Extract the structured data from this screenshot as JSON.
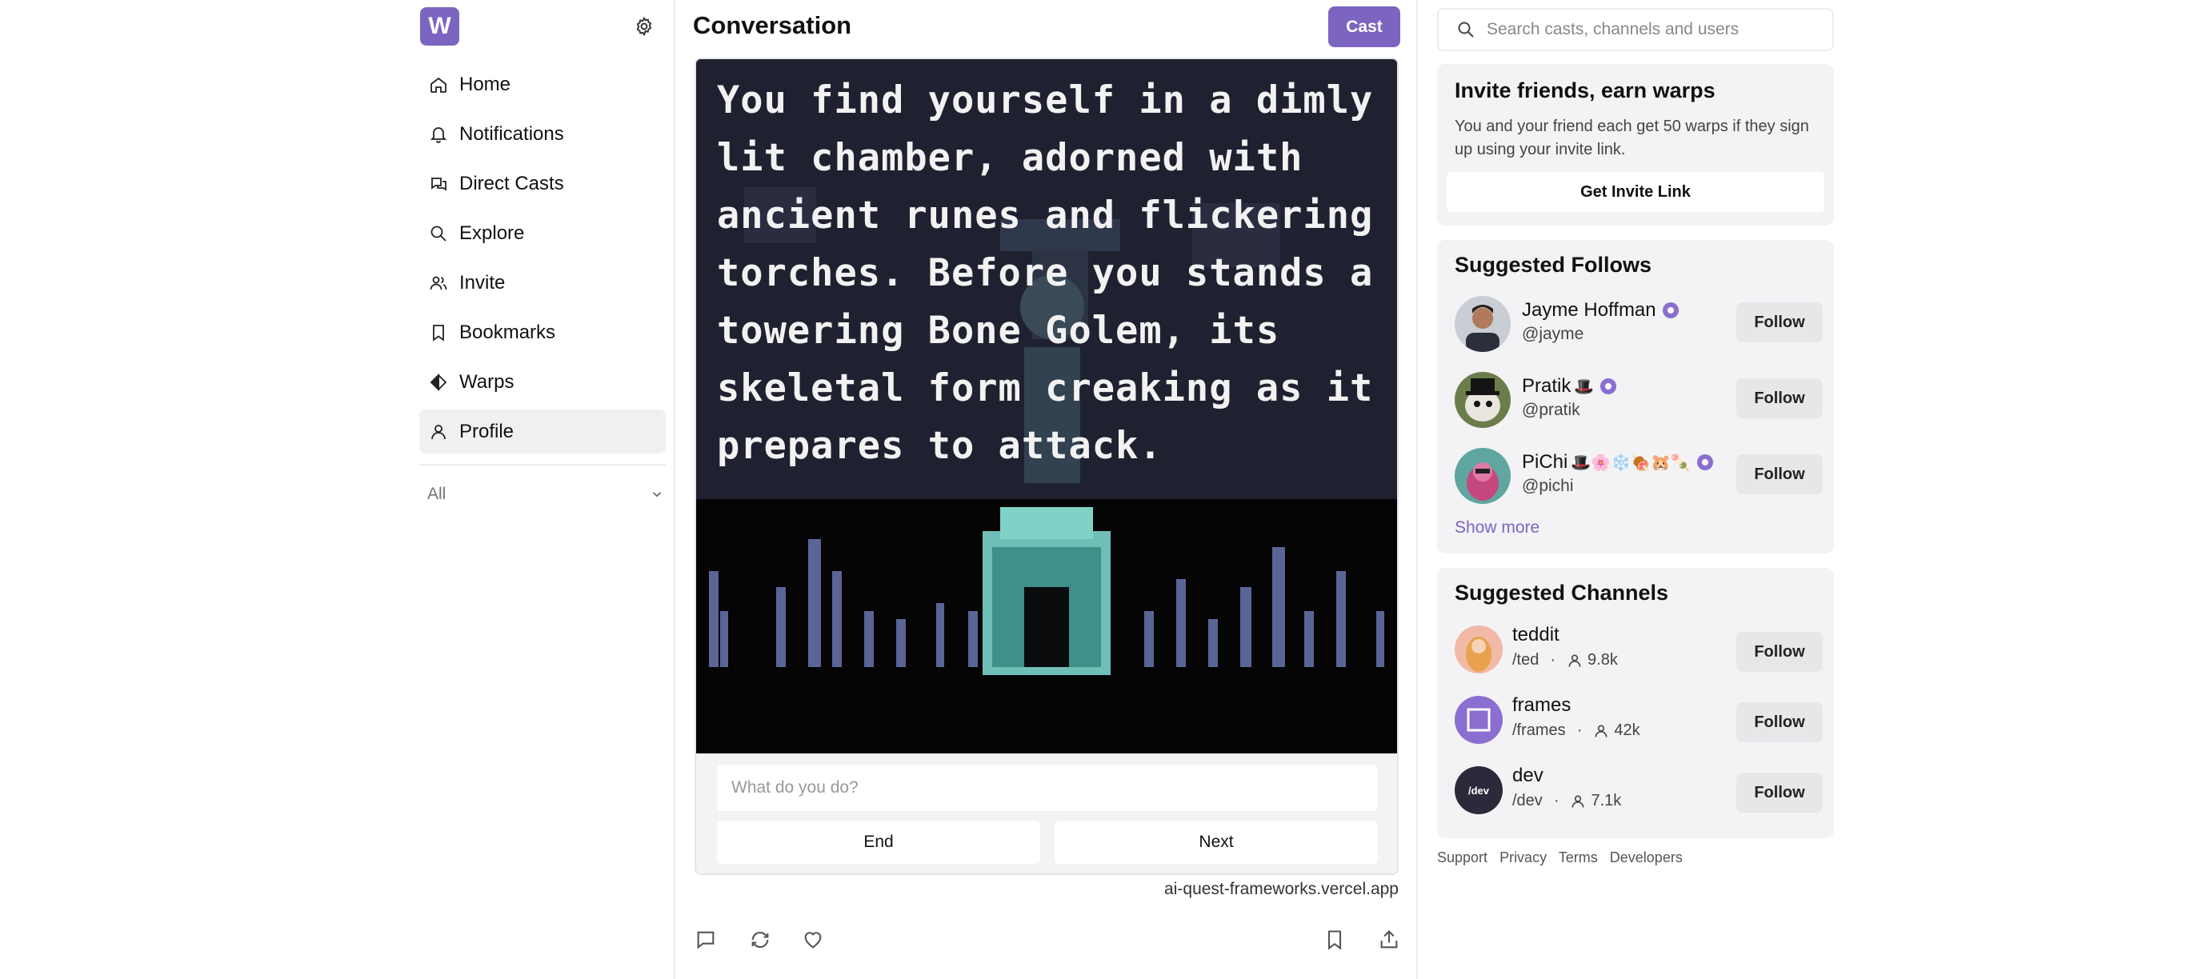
{
  "app": {
    "logo_letter": "W"
  },
  "sidebar": {
    "items": [
      {
        "label": "Home",
        "icon": "home-icon"
      },
      {
        "label": "Notifications",
        "icon": "bell-icon"
      },
      {
        "label": "Direct Casts",
        "icon": "chat-icon"
      },
      {
        "label": "Explore",
        "icon": "search-icon"
      },
      {
        "label": "Invite",
        "icon": "users-icon"
      },
      {
        "label": "Bookmarks",
        "icon": "bookmark-icon"
      },
      {
        "label": "Warps",
        "icon": "warp-icon"
      },
      {
        "label": "Profile",
        "icon": "user-icon",
        "active": true
      }
    ],
    "filter_label": "All"
  },
  "header": {
    "title": "Conversation",
    "cast_label": "Cast"
  },
  "frame": {
    "image_text": "You find yourself in a dimly lit chamber, adorned with ancient runes and flickering torches. Before you stands a towering Bone Golem, its skeletal form creaking as it prepares to attack.",
    "input_placeholder": "What do you do?",
    "buttons": [
      "End",
      "Next"
    ],
    "domain": "ai-quest-frameworks.vercel.app"
  },
  "search": {
    "placeholder": "Search casts, channels and users"
  },
  "invite": {
    "title": "Invite friends, earn warps",
    "description": "You and your friend each get 50 warps if they sign up using your invite link.",
    "button": "Get Invite Link"
  },
  "suggested_follows": {
    "title": "Suggested Follows",
    "users": [
      {
        "name": "Jayme Hoffman",
        "emoji": "",
        "handle": "@jayme"
      },
      {
        "name": "Pratik",
        "emoji": "🎩",
        "handle": "@pratik"
      },
      {
        "name": "PiChi",
        "emoji": "🎩🌸❄️🍖🐹🍡",
        "handle": "@pichi"
      }
    ],
    "follow_label": "Follow",
    "show_more": "Show more"
  },
  "suggested_channels": {
    "title": "Suggested Channels",
    "channels": [
      {
        "name": "teddit",
        "path": "/ted",
        "members": "9.8k"
      },
      {
        "name": "frames",
        "path": "/frames",
        "members": "42k"
      },
      {
        "name": "dev",
        "path": "/dev",
        "members": "7.1k",
        "avatar_text": "/dev"
      }
    ],
    "follow_label": "Follow"
  },
  "footer": {
    "links": [
      "Support",
      "Privacy",
      "Terms",
      "Developers"
    ]
  },
  "colors": {
    "brand": "#7c65c1",
    "panel": "#f3f3f5"
  }
}
